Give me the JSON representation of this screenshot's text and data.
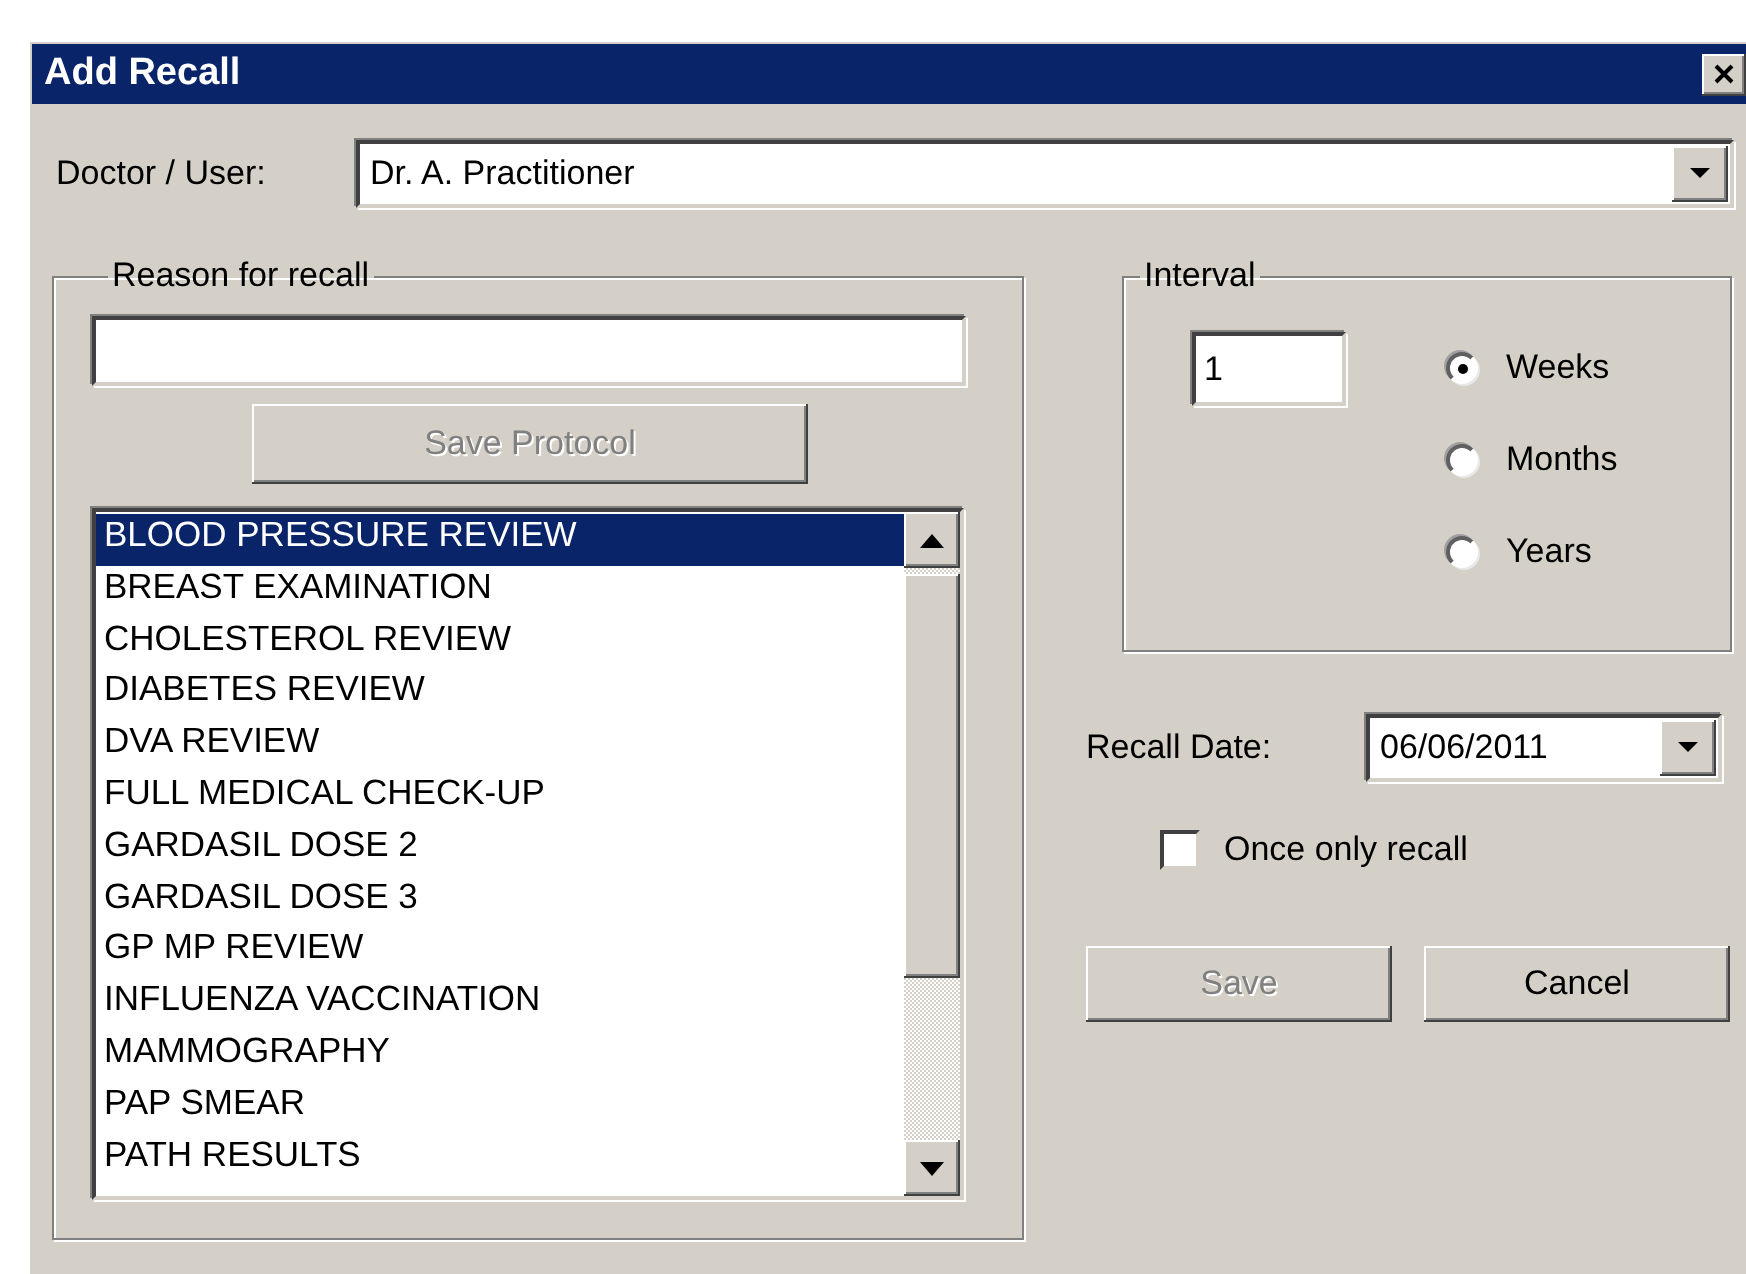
{
  "window": {
    "title": "Add Recall"
  },
  "doctor": {
    "label": "Doctor / User:",
    "value": "Dr. A. Practitioner"
  },
  "reason": {
    "legend": "Reason for recall"
  },
  "save_protocol": {
    "label": "Save Protocol",
    "disabled": true
  },
  "reasons": [
    {
      "label": "BLOOD PRESSURE REVIEW",
      "selected": true
    },
    {
      "label": "BREAST EXAMINATION",
      "selected": false
    },
    {
      "label": "CHOLESTEROL REVIEW",
      "selected": false
    },
    {
      "label": "DIABETES REVIEW",
      "selected": false
    },
    {
      "label": "DVA REVIEW",
      "selected": false
    },
    {
      "label": "FULL MEDICAL CHECK-UP",
      "selected": false
    },
    {
      "label": "GARDASIL DOSE 2",
      "selected": false
    },
    {
      "label": "GARDASIL DOSE 3",
      "selected": false
    },
    {
      "label": "GP MP REVIEW",
      "selected": false
    },
    {
      "label": "INFLUENZA VACCINATION",
      "selected": false
    },
    {
      "label": "MAMMOGRAPHY",
      "selected": false
    },
    {
      "label": "PAP SMEAR",
      "selected": false
    },
    {
      "label": "PATH RESULTS",
      "selected": false
    }
  ],
  "interval": {
    "legend": "Interval",
    "value": "1",
    "units": [
      {
        "label": "Weeks",
        "selected": true
      },
      {
        "label": "Months",
        "selected": false
      },
      {
        "label": "Years",
        "selected": false
      }
    ]
  },
  "recall_date": {
    "label": "Recall Date:",
    "value": "06/06/2011"
  },
  "once_only": {
    "label": "Once only recall",
    "checked": false
  },
  "buttons": [
    {
      "label": "Save",
      "disabled": true
    },
    {
      "label": "Cancel",
      "disabled": false
    }
  ]
}
